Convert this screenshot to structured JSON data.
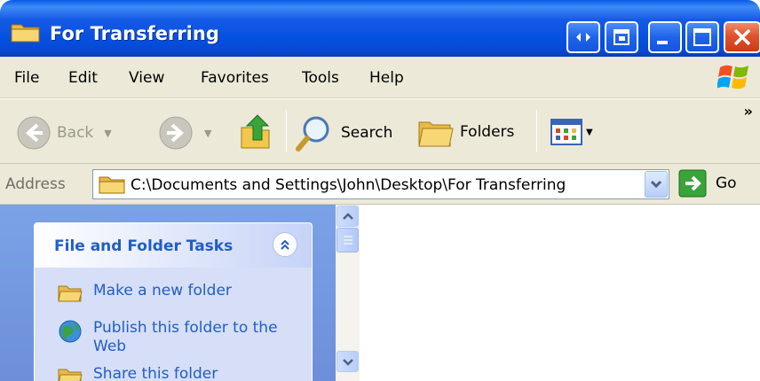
{
  "window": {
    "title": "For Transferring",
    "title_bar_color": "#0a5ae8",
    "close_color": "#e0532e"
  },
  "menu": {
    "items": [
      "File",
      "Edit",
      "View",
      "Favorites",
      "Tools",
      "Help"
    ]
  },
  "toolbar": {
    "back_label": "Back",
    "search_label": "Search",
    "folders_label": "Folders",
    "overflow": "»"
  },
  "address": {
    "label": "Address",
    "value": "C:\\Documents and Settings\\John\\Desktop\\For Transferring",
    "go_label": "Go"
  },
  "tasks": {
    "title": "File and Folder Tasks",
    "items": [
      {
        "label": "Make a new folder",
        "icon": "new-folder-icon"
      },
      {
        "label": "Publish this folder to the Web",
        "icon": "publish-web-icon"
      },
      {
        "label": "Share this folder",
        "icon": "share-folder-icon"
      }
    ]
  }
}
